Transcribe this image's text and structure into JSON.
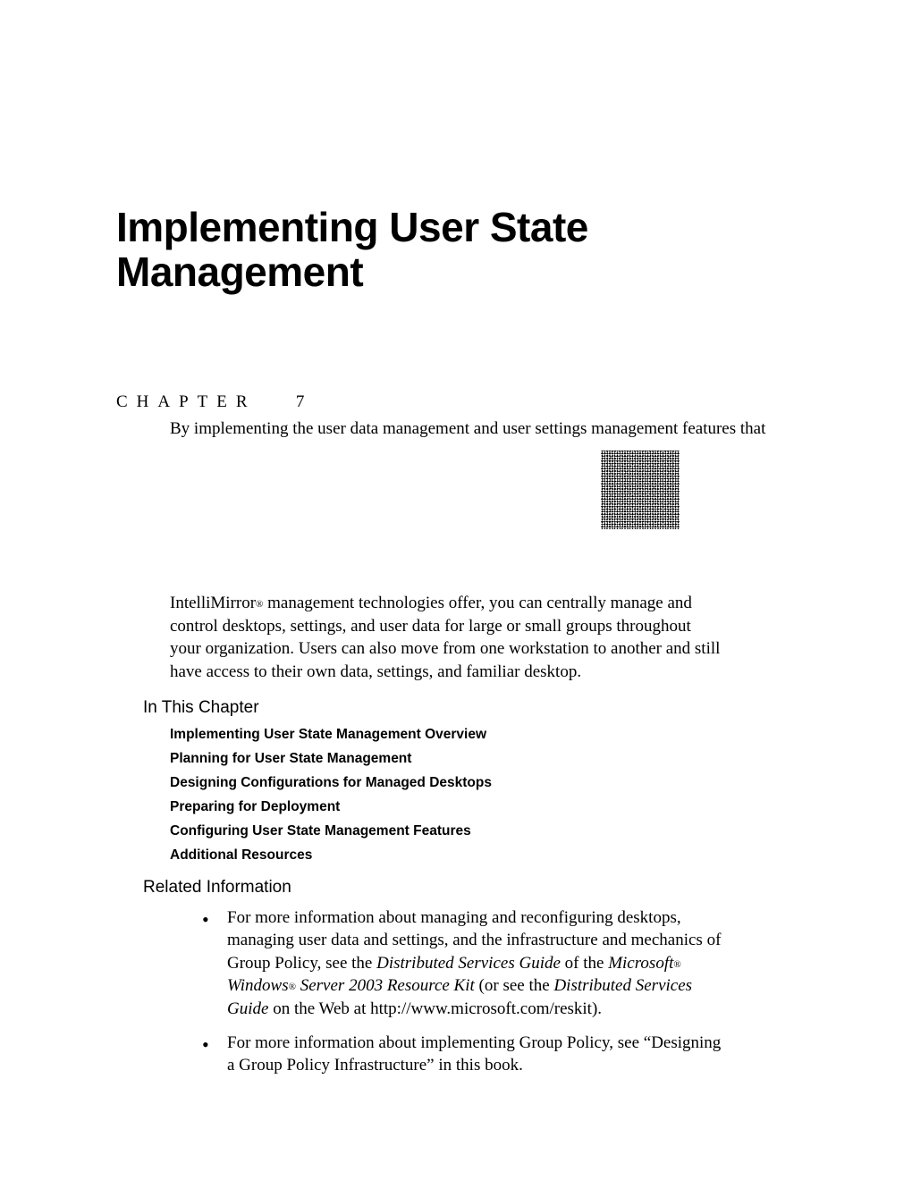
{
  "title": "Implementing User State Management",
  "chapter": {
    "label": "CHAPTER",
    "number": "7"
  },
  "intro_line": "By implementing the user data management and user settings management features that",
  "body_para_parts": {
    "p1": "IntelliMirror",
    "p1_reg": "®",
    "p2": " management technologies offer, you can centrally manage and control desktops, settings, and user data for large or small groups throughout your organization. Users can also move from one workstation to another and still have access to their own data, settings, and familiar desktop."
  },
  "sections": {
    "in_this_chapter": "In This Chapter",
    "related_info": "Related Information"
  },
  "toc": [
    "Implementing User State Management Overview",
    "Planning for User State Management",
    "Designing Configurations for Managed Desktops",
    "Preparing for Deployment",
    "Configuring User State Management Features",
    "Additional Resources"
  ],
  "related": {
    "item1": {
      "t1": "For more information about managing and reconfiguring desktops, managing user data and settings, and the infrastructure and mechanics of Group Policy, see the ",
      "i1": "Distributed Services Guide",
      "t2": " of the ",
      "i2": "Microsoft",
      "reg2": "®",
      "t3": " ",
      "i3": "Windows",
      "reg3": "®",
      "t4": " ",
      "i4": "Server 2003 Resource Kit",
      "t5": " (or see the ",
      "i5": "Distributed Services Guide",
      "t6": " on the Web at http://www.microsoft.com/reskit)."
    },
    "item2": {
      "t1": "For more information about implementing Group Policy, see “Designing a Group Policy Infrastructure” in this book."
    }
  }
}
